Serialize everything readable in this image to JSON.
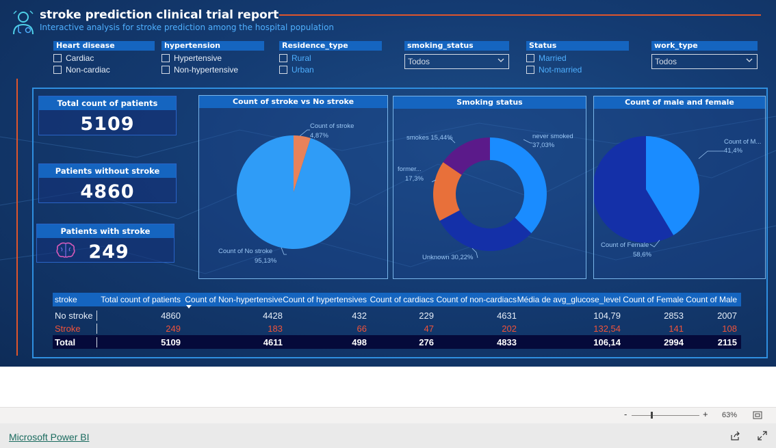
{
  "header": {
    "title": "stroke prediction clinical trial report",
    "subtitle": "Interactive analysis for stroke prediction among the hospital population"
  },
  "slicers": {
    "heart_disease": {
      "title": "Heart disease",
      "options": [
        "Cardiac",
        "Non-cardiac"
      ]
    },
    "hypertension": {
      "title": "hypertension",
      "options": [
        "Hypertensive",
        "Non-hypertensive"
      ]
    },
    "residence": {
      "title": "Residence_type",
      "options": [
        "Rural",
        "Urban"
      ]
    },
    "smoking": {
      "title": "smoking_status",
      "value": "Todos"
    },
    "status": {
      "title": "Status",
      "options": [
        "Married",
        "Not-married"
      ]
    },
    "work_type": {
      "title": "work_type",
      "value": "Todos"
    }
  },
  "cards": {
    "total": {
      "label": "Total count of patients",
      "value": "5109"
    },
    "without": {
      "label": "Patients without stroke",
      "value": "4860"
    },
    "with": {
      "label": "Patients with stroke",
      "value": "249"
    }
  },
  "charts": {
    "stroke": {
      "title": "Count of stroke vs No stroke",
      "stroke_label": "Count of stroke",
      "stroke_pct": "4,87%",
      "nostroke_label": "Count of No stroke",
      "nostroke_pct": "95,13%"
    },
    "smoking": {
      "title": "Smoking status",
      "never_label": "never smoked",
      "never_pct": "37,03%",
      "unknown_label": "Unknown 30,22%",
      "former_label": "former...",
      "former_pct": "17,3%",
      "smokes_label": "smokes 15,44%"
    },
    "gender": {
      "title": "Count of male and female",
      "male_label": "Count of M...",
      "male_pct": "41,4%",
      "female_label": "Count of Female",
      "female_pct": "58,6%"
    }
  },
  "chart_data": [
    {
      "type": "pie",
      "title": "Count of stroke vs No stroke",
      "categories": [
        "Count of stroke",
        "Count of No stroke"
      ],
      "values": [
        4.87,
        95.13
      ],
      "colors": [
        "#e8825a",
        "#2f9cf7"
      ]
    },
    {
      "type": "pie",
      "title": "Smoking status",
      "donut": true,
      "categories": [
        "never smoked",
        "Unknown",
        "former...",
        "smokes"
      ],
      "values": [
        37.03,
        30.22,
        17.3,
        15.44
      ],
      "colors": [
        "#1a8cff",
        "#1430a8",
        "#e8703a",
        "#5b1a8a"
      ]
    },
    {
      "type": "pie",
      "title": "Count of male and female",
      "categories": [
        "Count of M...",
        "Count of Female"
      ],
      "values": [
        41.4,
        58.6
      ],
      "colors": [
        "#1a8cff",
        "#1430a8"
      ]
    }
  ],
  "table": {
    "headers": [
      "stroke",
      "Total count of patients",
      "Count of Non-hypertensive",
      "Count of hypertensives",
      "Count of cardiacs",
      "Count of non-cardiacs",
      "Média de avg_glucose_level",
      "Count of Female",
      "Count of Male"
    ],
    "rows": [
      [
        "No stroke",
        "4860",
        "4428",
        "432",
        "229",
        "4631",
        "104,79",
        "2853",
        "2007"
      ],
      [
        "Stroke",
        "249",
        "183",
        "66",
        "47",
        "202",
        "132,54",
        "141",
        "108"
      ]
    ],
    "total": [
      "Total",
      "5109",
      "4611",
      "498",
      "276",
      "4833",
      "106,14",
      "2994",
      "2115"
    ],
    "colors": {
      "normal": "#e6eef8",
      "stroke": "#f0533a"
    }
  },
  "footer": {
    "zoom": "63%",
    "link": "Microsoft Power BI"
  }
}
